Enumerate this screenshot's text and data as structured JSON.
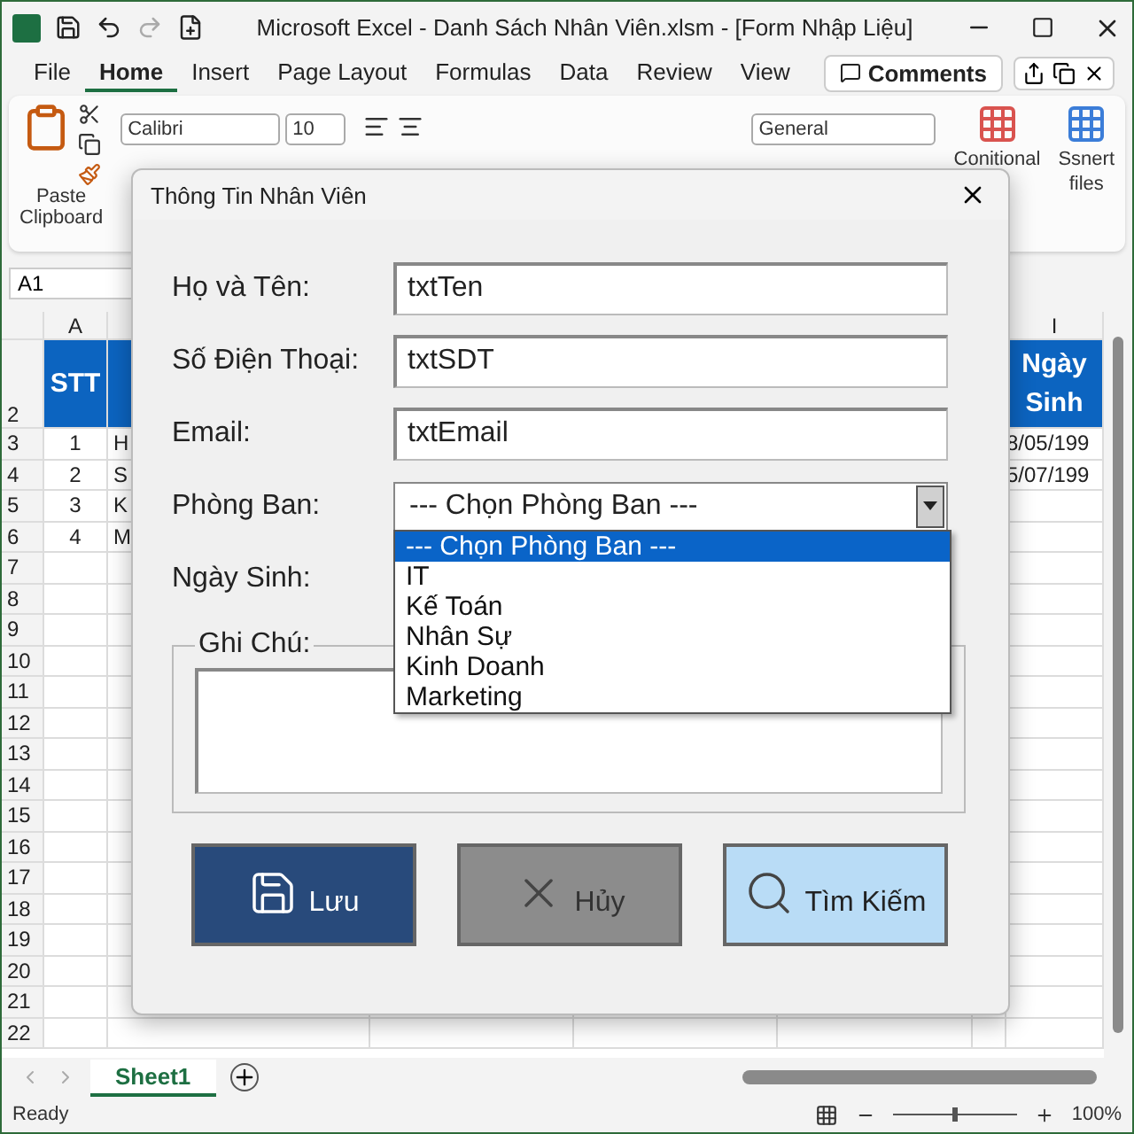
{
  "window": {
    "title": "Microsoft Excel - Danh Sách Nhân Viên.xlsm - [Form Nhập Liệu]"
  },
  "menu_tabs": [
    {
      "label": "File",
      "selected": false
    },
    {
      "label": "Home",
      "selected": true
    },
    {
      "label": "Insert",
      "selected": false
    },
    {
      "label": "Page Layout",
      "selected": false
    },
    {
      "label": "Formulas",
      "selected": false
    },
    {
      "label": "Data",
      "selected": false
    },
    {
      "label": "Review",
      "selected": false
    },
    {
      "label": "View",
      "selected": false
    }
  ],
  "comments_button": "Comments",
  "ribbon": {
    "paste": "Paste",
    "clipboard": "Clipboard",
    "font": "Calibri",
    "font_size": "10",
    "number_format": "General",
    "conditional": "Conitional",
    "styles": [
      "Ssnert",
      "files"
    ]
  },
  "name_box": "A1",
  "sheet": {
    "column_headers": [
      "A",
      "I"
    ],
    "header_row": {
      "number": "2",
      "cells": [
        "STT",
        "Ngày Sinh"
      ]
    },
    "rows": [
      {
        "number": "3",
        "cells": [
          "1",
          "H",
          "8/05/199"
        ]
      },
      {
        "number": "4",
        "cells": [
          "2",
          "S",
          "5/07/199"
        ]
      },
      {
        "number": "5",
        "cells": [
          "3",
          "K"
        ]
      },
      {
        "number": "6",
        "cells": [
          "4",
          "M"
        ]
      },
      {
        "number": "7"
      },
      {
        "number": "8"
      },
      {
        "number": "9"
      },
      {
        "number": "10"
      },
      {
        "number": "11"
      },
      {
        "number": "12"
      },
      {
        "number": "13"
      },
      {
        "number": "14"
      },
      {
        "number": "15"
      },
      {
        "number": "16"
      },
      {
        "number": "17"
      },
      {
        "number": "18"
      },
      {
        "number": "19"
      },
      {
        "number": "20"
      },
      {
        "number": "21"
      },
      {
        "number": "22"
      }
    ]
  },
  "sheet_tabs": [
    {
      "label": "Sheet1",
      "selected": true
    }
  ],
  "status_bar": {
    "status": "Ready",
    "zoom": "100%",
    "zoom_slider": {
      "level": 0.5
    }
  },
  "dialog": {
    "title": "Thông Tin Nhân Viên",
    "fields": [
      {
        "label": "Họ và Tên:",
        "kind": "text",
        "value": "txtTen"
      },
      {
        "label": "Số Điện Thoại:",
        "kind": "text",
        "value": "txtSDT"
      },
      {
        "label": "Email:",
        "kind": "text",
        "value": "txtEmail"
      },
      {
        "label": "Phòng Ban:",
        "kind": "combo",
        "value": "--- Chọn Phòng Ban ---",
        "expanded": true,
        "options": [
          {
            "label": "--- Chọn Phòng Ban ---",
            "selected": true
          },
          {
            "label": "IT",
            "selected": false
          },
          {
            "label": "Kế Toán",
            "selected": false
          },
          {
            "label": "Nhân Sự",
            "selected": false
          },
          {
            "label": "Kinh Doanh",
            "selected": false
          },
          {
            "label": "Marketing",
            "selected": false
          }
        ]
      },
      {
        "label": "Ngày Sinh:",
        "kind": "label"
      }
    ],
    "notes": {
      "label": "Ghi Chú:"
    },
    "buttons": [
      {
        "label": "Lưu",
        "kind": "save"
      },
      {
        "label": "Hủy",
        "kind": "cancel"
      },
      {
        "label": "Tìm Kiếm",
        "kind": "search"
      }
    ]
  }
}
